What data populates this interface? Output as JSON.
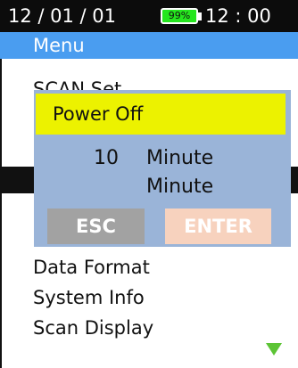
{
  "status": {
    "date": "12 / 01 / 01",
    "battery": "99%",
    "time": "12 : 00"
  },
  "menu": {
    "title": "Menu",
    "items": [
      {
        "label": "SCAN Set",
        "selected": false
      },
      {
        "label": "",
        "selected": false
      },
      {
        "label": "",
        "selected": false
      },
      {
        "label": "",
        "selected": true
      },
      {
        "label": "",
        "selected": false
      },
      {
        "label": "",
        "selected": false
      },
      {
        "label": "Data Format",
        "selected": false
      },
      {
        "label": "System Info",
        "selected": false
      },
      {
        "label": "Scan Display",
        "selected": false
      }
    ],
    "scroll_indicator": "triangle-down"
  },
  "dialog": {
    "title": "Power Off",
    "value": "10",
    "unit": "Minute",
    "unit_row2": "Minute",
    "esc_label": "ESC",
    "enter_label": "ENTER"
  },
  "colors": {
    "status_bg": "#0c0c0c",
    "menu_header_bg": "#4a9df0",
    "battery_fill": "#25e61e",
    "dialog_bg": "#9ab4d8",
    "dialog_title_bg": "#ecf200",
    "esc_bg": "#a2a2a2",
    "enter_bg": "#f7d2be",
    "scroll_arrow": "#5cc435"
  }
}
